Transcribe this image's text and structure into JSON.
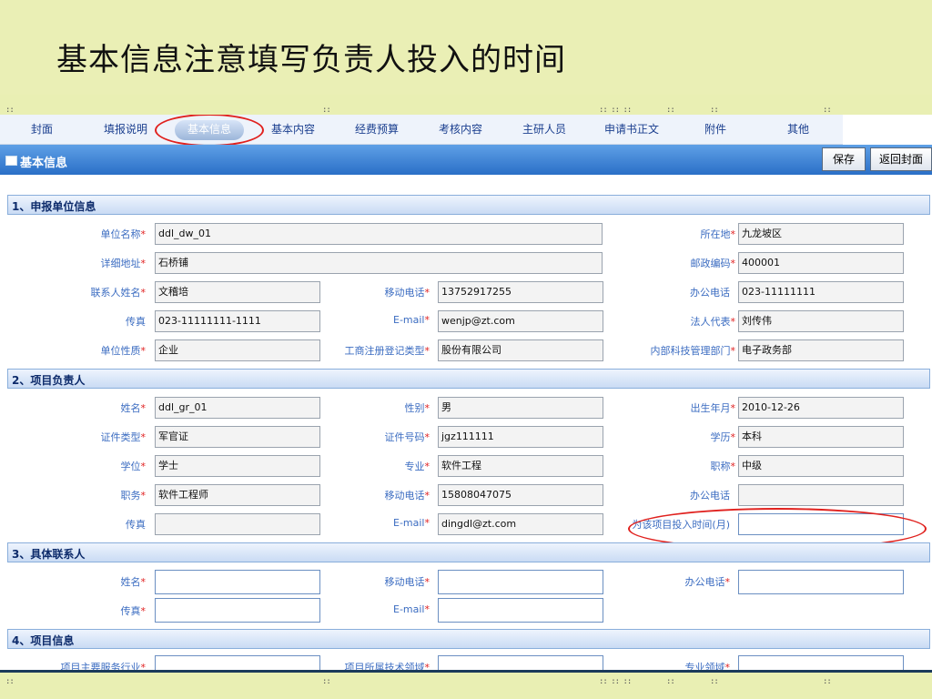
{
  "slide": {
    "title": "基本信息注意填写负责人投入的时间"
  },
  "tabs": [
    "封面",
    "填报说明",
    "基本信息",
    "基本内容",
    "经费预算",
    "考核内容",
    "主研人员",
    "申请书正文",
    "附件",
    "其他"
  ],
  "panel": {
    "title": "基本信息",
    "save_label": "保存",
    "back_label": "返回封面"
  },
  "section1": {
    "title": "1、申报单位信息",
    "unit_name_label": "单位名称",
    "unit_name": "ddl_dw_01",
    "location_label": "所在地",
    "location": "九龙坡区",
    "address_label": "详细地址",
    "address": "石桥铺",
    "postcode_label": "邮政编码",
    "postcode": "400001",
    "contact_label": "联系人姓名",
    "contact": "文稽培",
    "mobile_label": "移动电话",
    "mobile": "13752917255",
    "office_phone_label": "办公电话",
    "office_phone": "023-11111111",
    "fax_label": "传真",
    "fax": "023-11111111-1111",
    "email_label": "E-mail",
    "email": "wenjp@zt.com",
    "legal_rep_label": "法人代表",
    "legal_rep": "刘传伟",
    "unit_type_label": "单位性质",
    "unit_type": "企业",
    "reg_type_label": "工商注册登记类型",
    "reg_type": "股份有限公司",
    "tech_dept_label": "内部科技管理部门",
    "tech_dept": "电子政务部"
  },
  "section2": {
    "title": "2、项目负责人",
    "name_label": "姓名",
    "name": "ddl_gr_01",
    "gender_label": "性别",
    "gender": "男",
    "birth_label": "出生年月",
    "birth": "2010-12-26",
    "id_type_label": "证件类型",
    "id_type": "军官证",
    "id_no_label": "证件号码",
    "id_no": "jgz111111",
    "education_label": "学历",
    "education": "本科",
    "degree_label": "学位",
    "degree": "学士",
    "major_label": "专业",
    "major": "软件工程",
    "title_label": "职称",
    "title_value": "中级",
    "position_label": "职务",
    "position": "软件工程师",
    "mobile_label": "移动电话",
    "mobile": "15808047075",
    "office_phone_label": "办公电话",
    "fax_label": "传真",
    "email_label": "E-mail",
    "email": "dingdl@zt.com",
    "months_label": "为该项目投入时间(月)"
  },
  "section3": {
    "title": "3、具体联系人",
    "name_label": "姓名",
    "mobile_label": "移动电话",
    "office_phone_label": "办公电话",
    "fax_label": "传真",
    "email_label": "E-mail"
  },
  "section4": {
    "title": "4、项目信息",
    "service_label": "项目主要服务行业",
    "tech_field_label": "项目所属技术领域",
    "special_field_label": "专业领域"
  },
  "colors": {
    "accent_red": "#e0211e",
    "label_blue": "#3b6cc1",
    "titlebar_blue": "#2a6fc7"
  }
}
